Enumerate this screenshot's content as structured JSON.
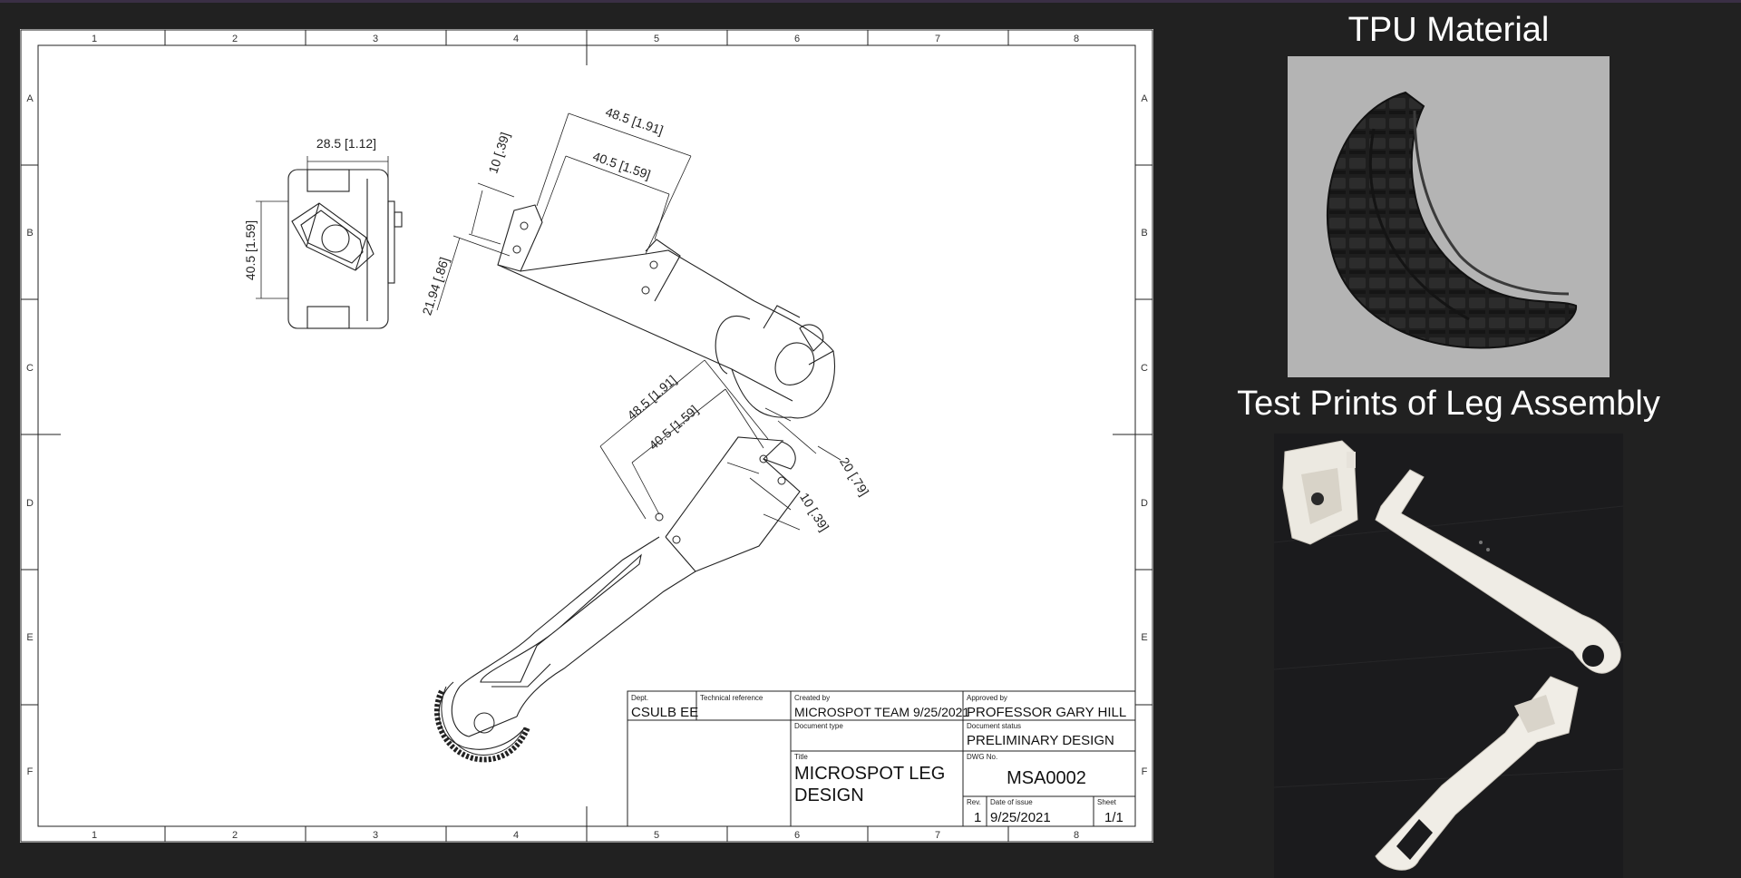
{
  "drawing": {
    "zone_numbers": [
      "1",
      "2",
      "3",
      "4",
      "5",
      "6",
      "7",
      "8"
    ],
    "zone_letters": [
      "A",
      "B",
      "C",
      "D",
      "E",
      "F"
    ],
    "dimensions": {
      "top_view_width": "28.5 [1.12]",
      "top_view_height": "40.5 [1.59]",
      "upper_leg_outer": "48.5 [1.91]",
      "upper_leg_inner": "40.5 [1.59]",
      "upper_leg_tab": "10 [.39]",
      "upper_leg_offset": "21.94 [.86]",
      "lower_leg_outer": "48.5 [1.91]",
      "lower_leg_inner": "40.5 [1.59]",
      "lower_leg_width": "20 [.79]",
      "lower_leg_tab": "10 [.39]"
    },
    "title_block": {
      "dept_label": "Dept.",
      "dept": "CSULB EE",
      "tech_ref_label": "Technical reference",
      "created_by_label": "Created by",
      "created_by": "MICROSPOT TEAM 9/25/2021",
      "approved_by_label": "Approved by",
      "approved_by": "PROFESSOR GARY HILL",
      "doc_type_label": "Document type",
      "doc_status_label": "Document status",
      "doc_status": "PRELIMINARY DESIGN",
      "title_label": "Title",
      "title_line1": "MICROSPOT LEG",
      "title_line2": "DESIGN",
      "dwg_no_label": "DWG No.",
      "dwg_no": "MSA0002",
      "rev_label": "Rev.",
      "rev": "1",
      "date_label": "Date of issue",
      "date": "9/25/2021",
      "sheet_label": "Sheet",
      "sheet": "1/1"
    }
  },
  "side": {
    "tpu_title": "TPU Material",
    "test_title": "Test Prints of Leg Assembly"
  }
}
